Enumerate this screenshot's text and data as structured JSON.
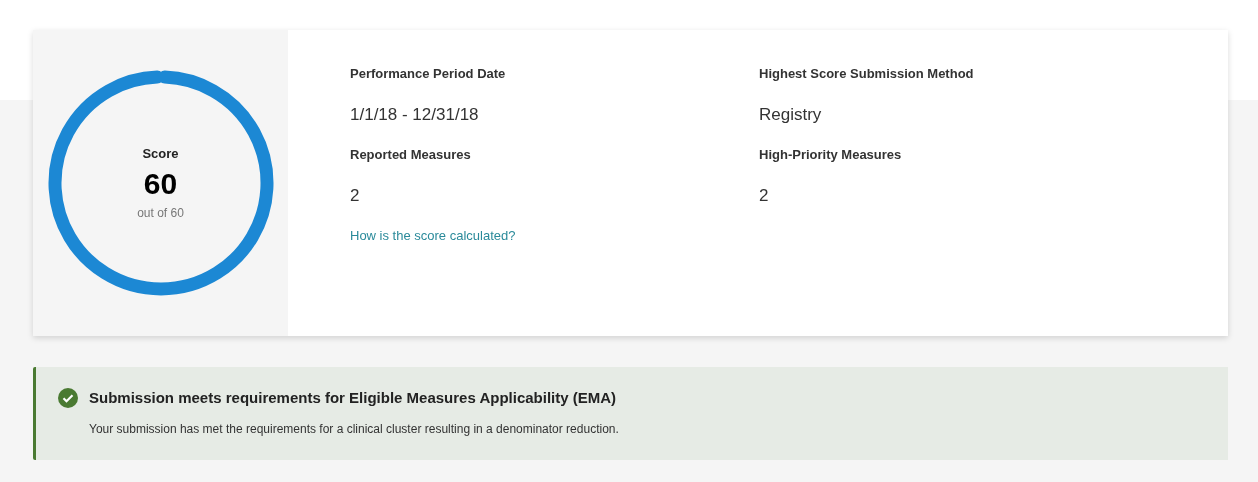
{
  "score": {
    "label": "Score",
    "value": "60",
    "out_of": "out of 60"
  },
  "fields": [
    {
      "label": "Performance Period Date",
      "value": "1/1/18 - 12/31/18"
    },
    {
      "label": "Highest Score Submission Method",
      "value": "Registry"
    },
    {
      "label": "Reported Measures",
      "value": "2"
    },
    {
      "label": "High-Priority Measures",
      "value": "2"
    }
  ],
  "link": "How is the score calculated?",
  "alert": {
    "title": "Submission meets requirements for Eligible Measures Applicability (EMA)",
    "message": "Your submission has met the requirements for a clinical cluster resulting in a denominator reduction."
  }
}
